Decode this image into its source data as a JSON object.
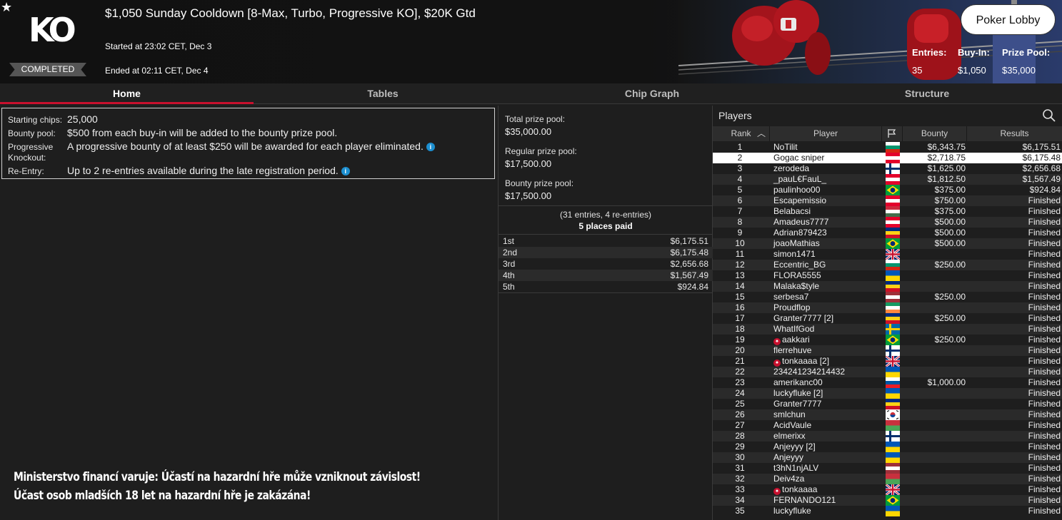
{
  "header": {
    "logo_text": "KO",
    "status_badge": "COMPLETED",
    "title": "$1,050 Sunday Cooldown [8-Max, Turbo, Progressive KO], $20K Gtd",
    "started": "Started at 23:02 CET, Dec 3",
    "ended": "Ended at 02:11 CET, Dec 4",
    "lobby_button": "Poker Lobby",
    "stats": [
      {
        "label": "Entries:",
        "value": "35"
      },
      {
        "label": "Buy-In:",
        "value": "$1,050"
      },
      {
        "label": "Prize Pool:",
        "value": "$35,000"
      }
    ]
  },
  "tabs": [
    "Home",
    "Tables",
    "Chip Graph",
    "Structure"
  ],
  "info": {
    "starting_chips_label": "Starting chips:",
    "starting_chips": "25,000",
    "bounty_pool_label": "Bounty pool:",
    "bounty_pool": "$500 from each buy-in will be added to the bounty prize pool.",
    "pko_label_1": "Progressive",
    "pko_label_2": "Knockout:",
    "pko": "A progressive bounty of at least $250 will be awarded for each player eliminated.",
    "reentry_label": "Re-Entry:",
    "reentry": "Up to 2 re-entries available during the late registration period."
  },
  "warning": {
    "line1": "Ministerstvo financí varuje: Účastí na hazardní hře může vzniknout závislost!",
    "line2": "Účast osob mladších 18 let na hazardní hře je zakázána!"
  },
  "prizes": {
    "total_label": "Total prize pool:",
    "total": "$35,000.00",
    "regular_label": "Regular prize pool:",
    "regular": "$17,500.00",
    "bounty_label": "Bounty prize pool:",
    "bounty": "$17,500.00",
    "entries_note": "(31 entries, 4 re-entries)",
    "places_paid": "5 places paid",
    "payouts": [
      {
        "place": "1st",
        "amount": "$6,175.51"
      },
      {
        "place": "2nd",
        "amount": "$6,175.48"
      },
      {
        "place": "3rd",
        "amount": "$2,656.68"
      },
      {
        "place": "4th",
        "amount": "$1,567.49"
      },
      {
        "place": "5th",
        "amount": "$924.84"
      }
    ]
  },
  "players": {
    "title": "Players",
    "columns": [
      "Rank",
      "Player",
      "Bounty",
      "Results"
    ],
    "flag_colors": {
      "AT": [
        "#e4002b",
        "#ffffff",
        "#e4002b"
      ],
      "FI": "nordic-blue",
      "BR": "brazil",
      "LV": [
        "#9e3039",
        "#ffffff",
        "#9e3039"
      ],
      "HU": [
        "#cd2a3e",
        "#ffffff",
        "#436f4d"
      ],
      "RO": [
        "#002b7f",
        "#fcd116",
        "#ce1126"
      ],
      "GB": "union-jack",
      "BG": [
        "#ffffff",
        "#00966e",
        "#d62612"
      ],
      "UA": [
        "#0057b7",
        "#ffd700"
      ],
      "IE": [
        "#169b62",
        "#ffffff",
        "#ff883e"
      ],
      "SE": "swedish-cross",
      "SI": [
        "#ffffff",
        "#0056a3",
        "#ed1c24"
      ],
      "KR": "korea",
      "BY": [
        "#c8313e",
        "#4aa657"
      ],
      "PL": [
        "#ffffff",
        "#dc143c"
      ]
    },
    "rows": [
      {
        "rank": "1",
        "name": "NoTilit",
        "flag": "BG",
        "bounty": "$6,343.75",
        "result": "$6,175.51",
        "ps": false
      },
      {
        "rank": "2",
        "name": "Gogac sniper",
        "flag": "AT",
        "bounty": "$2,718.75",
        "result": "$6,175.48",
        "ps": false
      },
      {
        "rank": "3",
        "name": "zerodeda",
        "flag": "FI",
        "bounty": "$1,625.00",
        "result": "$2,656.68",
        "ps": false
      },
      {
        "rank": "4",
        "name": "_pauL€FauL_",
        "flag": "AT",
        "bounty": "$1,812.50",
        "result": "$1,567.49",
        "ps": false
      },
      {
        "rank": "5",
        "name": "paulinhoo00",
        "flag": "BR",
        "bounty": "$375.00",
        "result": "$924.84",
        "ps": false
      },
      {
        "rank": "6",
        "name": "Escapemissio",
        "flag": "AT",
        "bounty": "$750.00",
        "result": "Finished",
        "ps": false
      },
      {
        "rank": "7",
        "name": "Belabacsi",
        "flag": "HU",
        "bounty": "$375.00",
        "result": "Finished",
        "ps": false
      },
      {
        "rank": "8",
        "name": "Amadeus7777",
        "flag": "AT",
        "bounty": "$500.00",
        "result": "Finished",
        "ps": false
      },
      {
        "rank": "9",
        "name": "Adrian879423",
        "flag": "RO",
        "bounty": "$500.00",
        "result": "Finished",
        "ps": false
      },
      {
        "rank": "10",
        "name": "joaoMathias",
        "flag": "BR",
        "bounty": "$500.00",
        "result": "Finished",
        "ps": false
      },
      {
        "rank": "11",
        "name": "simon1471",
        "flag": "GB",
        "bounty": "",
        "result": "Finished",
        "ps": false
      },
      {
        "rank": "12",
        "name": "Eccentric_BG",
        "flag": "BG",
        "bounty": "$250.00",
        "result": "Finished",
        "ps": false
      },
      {
        "rank": "13",
        "name": "FLORA5555",
        "flag": "UA",
        "bounty": "",
        "result": "Finished",
        "ps": false
      },
      {
        "rank": "14",
        "name": "Malaka$tyle",
        "flag": "RO",
        "bounty": "",
        "result": "Finished",
        "ps": false
      },
      {
        "rank": "15",
        "name": "serbesa7",
        "flag": "LV",
        "bounty": "$250.00",
        "result": "Finished",
        "ps": false
      },
      {
        "rank": "16",
        "name": "Proudflop",
        "flag": "IE",
        "bounty": "",
        "result": "Finished",
        "ps": false
      },
      {
        "rank": "17",
        "name": "Granter7777 [2]",
        "flag": "RO",
        "bounty": "$250.00",
        "result": "Finished",
        "ps": false
      },
      {
        "rank": "18",
        "name": "WhatIfGod",
        "flag": "SE",
        "bounty": "",
        "result": "Finished",
        "ps": false
      },
      {
        "rank": "19",
        "name": "aakkari",
        "flag": "BR",
        "bounty": "$250.00",
        "result": "Finished",
        "ps": true
      },
      {
        "rank": "20",
        "name": "flerrehuve",
        "flag": "FI",
        "bounty": "",
        "result": "Finished",
        "ps": false
      },
      {
        "rank": "21",
        "name": "tonkaaaa [2]",
        "flag": "GB",
        "bounty": "",
        "result": "Finished",
        "ps": true
      },
      {
        "rank": "22",
        "name": "234241234214432",
        "flag": "UA",
        "bounty": "",
        "result": "Finished",
        "ps": false
      },
      {
        "rank": "23",
        "name": "amerikanc00",
        "flag": "SI",
        "bounty": "$1,000.00",
        "result": "Finished",
        "ps": false
      },
      {
        "rank": "24",
        "name": "luckyfluke [2]",
        "flag": "UA",
        "bounty": "",
        "result": "Finished",
        "ps": false
      },
      {
        "rank": "25",
        "name": "Granter7777",
        "flag": "RO",
        "bounty": "",
        "result": "Finished",
        "ps": false
      },
      {
        "rank": "26",
        "name": "smlchun",
        "flag": "KR",
        "bounty": "",
        "result": "Finished",
        "ps": false
      },
      {
        "rank": "27",
        "name": "AcidVaule",
        "flag": "BY",
        "bounty": "",
        "result": "Finished",
        "ps": false
      },
      {
        "rank": "28",
        "name": "elmerixx",
        "flag": "FI",
        "bounty": "",
        "result": "Finished",
        "ps": false
      },
      {
        "rank": "29",
        "name": "Anjeyyy [2]",
        "flag": "UA",
        "bounty": "",
        "result": "Finished",
        "ps": false
      },
      {
        "rank": "30",
        "name": "Anjeyyy",
        "flag": "UA",
        "bounty": "",
        "result": "Finished",
        "ps": false
      },
      {
        "rank": "31",
        "name": "t3hN1njALV",
        "flag": "LV",
        "bounty": "",
        "result": "Finished",
        "ps": false
      },
      {
        "rank": "32",
        "name": "Deiv4za",
        "flag": "BY",
        "bounty": "",
        "result": "Finished",
        "ps": false
      },
      {
        "rank": "33",
        "name": "tonkaaaa",
        "flag": "GB",
        "bounty": "",
        "result": "Finished",
        "ps": true
      },
      {
        "rank": "34",
        "name": "FERNANDO121",
        "flag": "BR",
        "bounty": "",
        "result": "Finished",
        "ps": false
      },
      {
        "rank": "35",
        "name": "luckyfluke",
        "flag": "UA",
        "bounty": "",
        "result": "Finished",
        "ps": false
      }
    ]
  }
}
